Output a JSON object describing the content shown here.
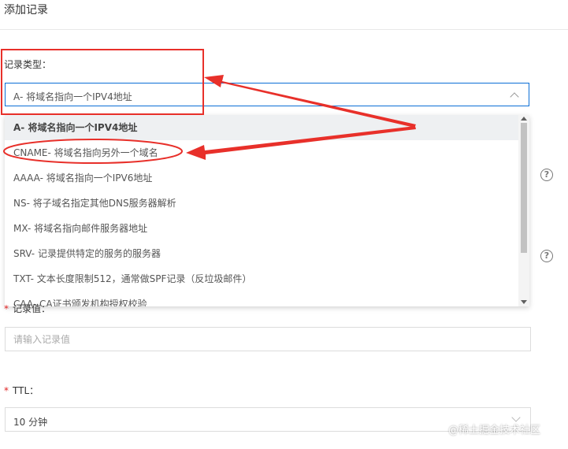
{
  "header": {
    "title": "添加记录"
  },
  "record_type": {
    "label": "记录类型：",
    "selected": "A- 将域名指向一个IPV4地址",
    "options": [
      "A- 将域名指向一个IPV4地址",
      "CNAME- 将域名指向另外一个域名",
      "AAAA- 将域名指向一个IPV6地址",
      "NS- 将子域名指定其他DNS服务器解析",
      "MX- 将域名指向邮件服务器地址",
      "SRV- 记录提供特定的服务的服务器",
      "TXT- 文本长度限制512，通常做SPF记录（反垃圾邮件）",
      "CAA- CA证书颁发机构授权校验"
    ]
  },
  "record_value": {
    "label": "记录值：",
    "placeholder": "请输入记录值",
    "required_mark": "*"
  },
  "ttl": {
    "label": "TTL：",
    "value": "10 分钟",
    "required_mark": "*"
  },
  "help": {
    "glyph": "?"
  },
  "watermark": "@稀土掘金技术社区",
  "colors": {
    "accent_border": "#0b6fd6",
    "annotation_red": "#e8302a",
    "required_red": "#e02424"
  }
}
